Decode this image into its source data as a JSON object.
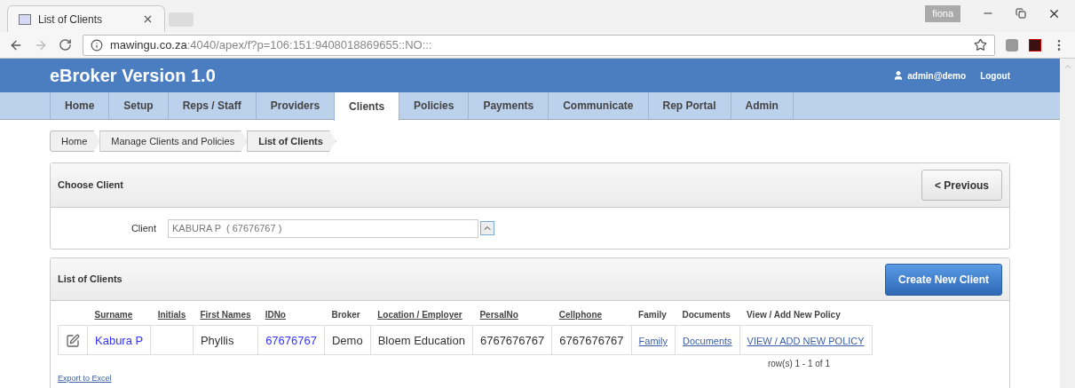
{
  "browser": {
    "tab_title": "List of Clients",
    "profile": "fiona",
    "url_host": "mawingu.co.za",
    "url_rest": ":4040/apex/f?p=106:151:9408018869655::NO:::"
  },
  "header": {
    "title": "eBroker Version 1.0",
    "user": "admin@demo",
    "logout": "Logout"
  },
  "nav": [
    {
      "label": "Home",
      "selected": false
    },
    {
      "label": "Setup",
      "selected": false
    },
    {
      "label": "Reps / Staff",
      "selected": false
    },
    {
      "label": "Providers",
      "selected": false
    },
    {
      "label": "Clients",
      "selected": true
    },
    {
      "label": "Policies",
      "selected": false
    },
    {
      "label": "Payments",
      "selected": false
    },
    {
      "label": "Communicate",
      "selected": false
    },
    {
      "label": "Rep Portal",
      "selected": false
    },
    {
      "label": "Admin",
      "selected": false
    }
  ],
  "breadcrumb": [
    {
      "label": "Home",
      "selected": false
    },
    {
      "label": "Manage Clients and Policies",
      "selected": false
    },
    {
      "label": "List of Clients",
      "selected": true
    }
  ],
  "choose_client": {
    "title": "Choose Client",
    "button": "< Previous",
    "field_label": "Client",
    "value": "KABURA P  ( 67676767 )"
  },
  "list": {
    "title": "List of Clients",
    "button": "Create New Client",
    "columns": [
      {
        "label": "Surname",
        "sortable": true
      },
      {
        "label": "Initials",
        "sortable": true
      },
      {
        "label": "First Names",
        "sortable": true
      },
      {
        "label": "IDNo",
        "sortable": true
      },
      {
        "label": "Broker",
        "sortable": false
      },
      {
        "label": "Location / Employer",
        "sortable": true
      },
      {
        "label": "PersalNo",
        "sortable": true
      },
      {
        "label": "Cellphone",
        "sortable": true
      },
      {
        "label": "Family",
        "sortable": false
      },
      {
        "label": "Documents",
        "sortable": false
      },
      {
        "label": "View / Add New Policy",
        "sortable": false
      }
    ],
    "rows": [
      [
        {
          "kind": "link",
          "text": "Kabura P"
        },
        {
          "kind": "text"
        },
        {
          "kind": "text",
          "text": "Phyllis"
        },
        {
          "kind": "link",
          "text": "67676767"
        },
        {
          "kind": "text",
          "text": "Demo"
        },
        {
          "kind": "text",
          "text": "Bloem Education"
        },
        {
          "kind": "text",
          "text": "6767676767"
        },
        {
          "kind": "text",
          "text": "6767676767"
        },
        {
          "kind": "action",
          "text": "Family"
        },
        {
          "kind": "action",
          "text": "Documents"
        },
        {
          "kind": "action",
          "text": "VIEW / ADD NEW POLICY"
        }
      ]
    ],
    "pagination": "row(s) 1 - 1 of 1",
    "export": "Export to Excel"
  }
}
